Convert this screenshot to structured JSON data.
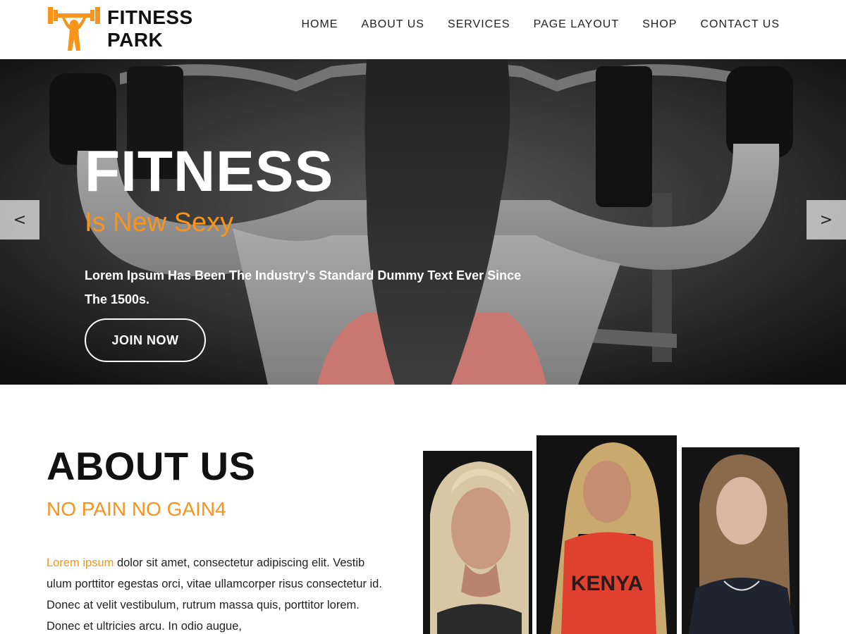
{
  "brand": {
    "line1": "FITNESS",
    "line2": "PARK",
    "logo_icon": "weightlifter-icon",
    "accent_color": "#f7941d"
  },
  "nav": {
    "items": [
      {
        "label": "HOME"
      },
      {
        "label": "ABOUT US"
      },
      {
        "label": "SERVICES"
      },
      {
        "label": "PAGE LAYOUT"
      },
      {
        "label": "SHOP"
      },
      {
        "label": "CONTACT US"
      }
    ]
  },
  "hero": {
    "title": "FITNESS",
    "subtitle": "Is New Sexy",
    "text": "Lorem Ipsum Has Been The Industry's Standard Dummy Text Ever Since The 1500s.",
    "button_label": "JOIN NOW",
    "prev_label": "<",
    "next_label": ">"
  },
  "about": {
    "title": "ABOUT US",
    "subtitle": "NO PAIN NO GAIN4",
    "text_highlight": "Lorem ipsum",
    "text_body": " dolor sit amet, consectetur adipiscing elit. Vestib ulum porttitor egestas orci, vitae ullamcorper risus consectetur id. Donec at velit vestibulum, rutrum massa quis, porttitor lorem. Donec et ultricies arcu. In odio augue,",
    "photo2_shirt_text": "KENYA"
  }
}
